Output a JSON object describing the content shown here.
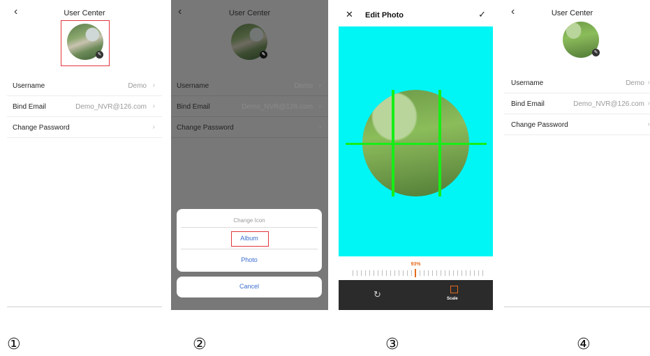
{
  "panel1": {
    "title": "User Center",
    "back_icon": "chevron-left-icon",
    "rows": [
      {
        "label": "Username",
        "value": "Demo"
      },
      {
        "label": "Bind Email",
        "value": "Demo_NVR@126.com"
      },
      {
        "label": "Change Password",
        "value": ""
      }
    ],
    "chevron": "›",
    "highlight_color": "#e2343b"
  },
  "panel2": {
    "title": "User Center",
    "rows": [
      {
        "label": "Username",
        "value": "Demo"
      },
      {
        "label": "Bind Email",
        "value": "Demo_NVR@126.com"
      },
      {
        "label": "Change Password",
        "value": ""
      }
    ],
    "chevron": "›",
    "sheet": {
      "title": "Change Icon",
      "album": "Album",
      "photo": "Photo",
      "cancel": "Cancel"
    }
  },
  "panel3": {
    "title": "Edit Photo",
    "close_glyph": "✕",
    "confirm_glyph": "✓",
    "zoom_label": "93%",
    "rotate_glyph": "↻",
    "scale_label": "Scale",
    "background_color": "#00f5f5",
    "grid_color": "#16ee16"
  },
  "panel4": {
    "title": "User Center",
    "rows": [
      {
        "label": "Username",
        "value": "Demo"
      },
      {
        "label": "Bind Email",
        "value": "Demo_NVR@126.com"
      },
      {
        "label": "Change Password",
        "value": ""
      }
    ],
    "chevron": "›"
  },
  "step_numbers": [
    "①",
    "②",
    "③",
    "④"
  ]
}
